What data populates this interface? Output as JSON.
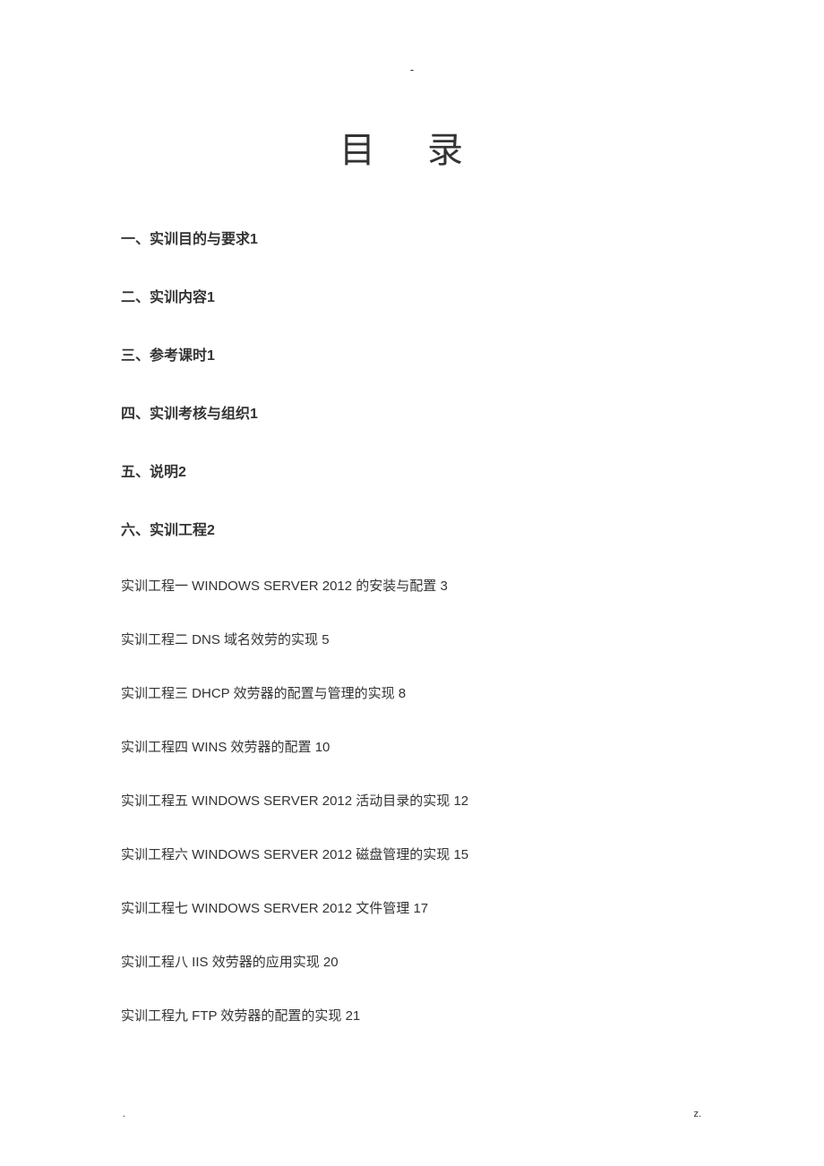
{
  "header_mark": "-",
  "title": "目 录",
  "toc_main": [
    {
      "text": "一、实训目的与要求",
      "page": "1"
    },
    {
      "text": "二、实训内容",
      "page": "1"
    },
    {
      "text": "三、参考课时",
      "page": "1"
    },
    {
      "text": "四、实训考核与组织",
      "page": "1"
    },
    {
      "text": "五、说明",
      "page": "2"
    },
    {
      "text": "六、实训工程",
      "page": "2"
    }
  ],
  "toc_sub": [
    {
      "prefix": "实训工程一",
      "title": " WINDOWS SERVER 2012 的安装与配置",
      "page": "3"
    },
    {
      "prefix": "实训工程二",
      "title": "   DNS 域名效劳的实现",
      "page": "5"
    },
    {
      "prefix": "实训工程三",
      "title": "   DHCP 效劳器的配置与管理的实现",
      "page": "8"
    },
    {
      "prefix": "实训工程四",
      "title": "   WINS 效劳器的配置",
      "page": "10"
    },
    {
      "prefix": "实训工程五",
      "title": "   WINDOWS SERVER 2012 活动目录的实现",
      "page": "12"
    },
    {
      "prefix": "实训工程六",
      "title": "   WINDOWS SERVER 2012 磁盘管理的实现",
      "page": "15"
    },
    {
      "prefix": "实训工程七",
      "title": "   WINDOWS SERVER 2012 文件管理",
      "page": "17"
    },
    {
      "prefix": "实训工程八",
      "title": "   IIS 效劳器的应用实现",
      "page": "20"
    },
    {
      "prefix": "实训工程九",
      "title": "   FTP 效劳器的配置的实现",
      "page": "21"
    }
  ],
  "footer_left": ".",
  "footer_right": "z."
}
